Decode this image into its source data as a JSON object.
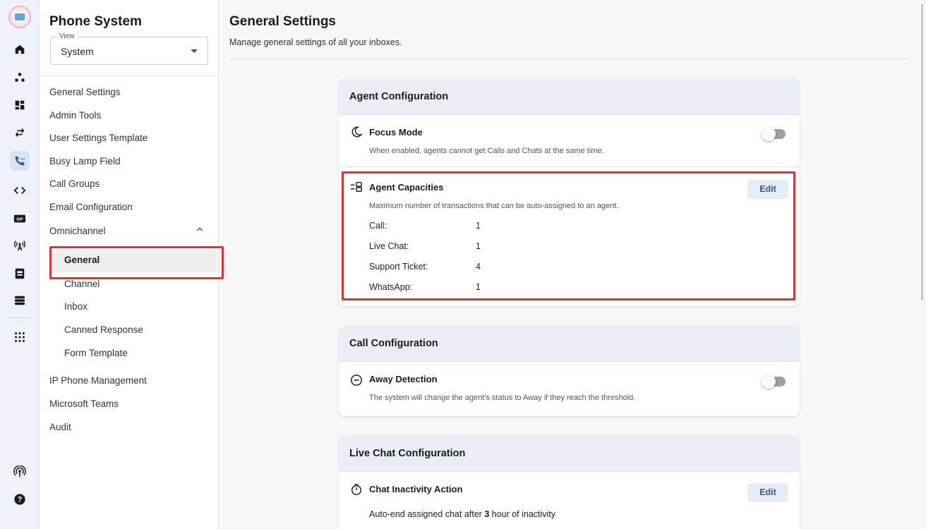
{
  "rail": {
    "icons": [
      "logo",
      "home-icon",
      "dots-icon",
      "dashboard-icon",
      "transfer-icon",
      "phone-icon",
      "code-icon",
      "sip-icon",
      "antenna-icon",
      "contacts-icon",
      "servers-icon",
      "apps-icon",
      "broadcast-icon",
      "help-icon"
    ],
    "sip_label": "SIP"
  },
  "sidebar": {
    "title": "Phone System",
    "view": {
      "legend": "View",
      "value": "System"
    },
    "items": [
      {
        "label": "General Settings"
      },
      {
        "label": "Admin Tools"
      },
      {
        "label": "User Settings Template"
      },
      {
        "label": "Busy Lamp Field"
      },
      {
        "label": "Call Groups"
      },
      {
        "label": "Email Configuration"
      },
      {
        "label": "Omnichannel"
      }
    ],
    "omnichannel_sub": [
      {
        "label": "General",
        "active": true
      },
      {
        "label": "Channel"
      },
      {
        "label": "Inbox"
      },
      {
        "label": "Canned Response"
      },
      {
        "label": "Form Template"
      }
    ],
    "items_after": [
      {
        "label": "IP Phone Management"
      },
      {
        "label": "Microsoft Teams"
      },
      {
        "label": "Audit"
      }
    ]
  },
  "main": {
    "title": "General Settings",
    "subtitle": "Manage general settings of all your inboxes.",
    "agent_config": {
      "header": "Agent Configuration",
      "focus_mode": {
        "title": "Focus Mode",
        "desc": "When enabled, agents cannot get Calls and Chats at the same time.",
        "enabled": false
      },
      "capacities": {
        "title": "Agent Capacities",
        "desc": "Maximum number of transactions that can be auto-assigned to an agent.",
        "edit": "Edit",
        "rows": [
          {
            "label": "Call:",
            "value": "1"
          },
          {
            "label": "Live Chat:",
            "value": "1"
          },
          {
            "label": "Support Ticket:",
            "value": "4"
          },
          {
            "label": "WhatsApp:",
            "value": "1"
          }
        ]
      }
    },
    "call_config": {
      "header": "Call Configuration",
      "away_detection": {
        "title": "Away Detection",
        "desc": "The system will change the agent's status to Away if they reach the threshold.",
        "enabled": false
      }
    },
    "live_chat_config": {
      "header": "Live Chat Configuration",
      "inactivity": {
        "title": "Chat Inactivity Action",
        "edit": "Edit",
        "text_before": "Auto-end assigned chat after ",
        "hours": "3",
        "text_after": " hour of inactivity"
      }
    }
  },
  "colors": {
    "highlight": "#e0332f",
    "accent": "#2b5c9a",
    "card_header": "#e9eef6",
    "rail_bg": "#eef3fb"
  }
}
